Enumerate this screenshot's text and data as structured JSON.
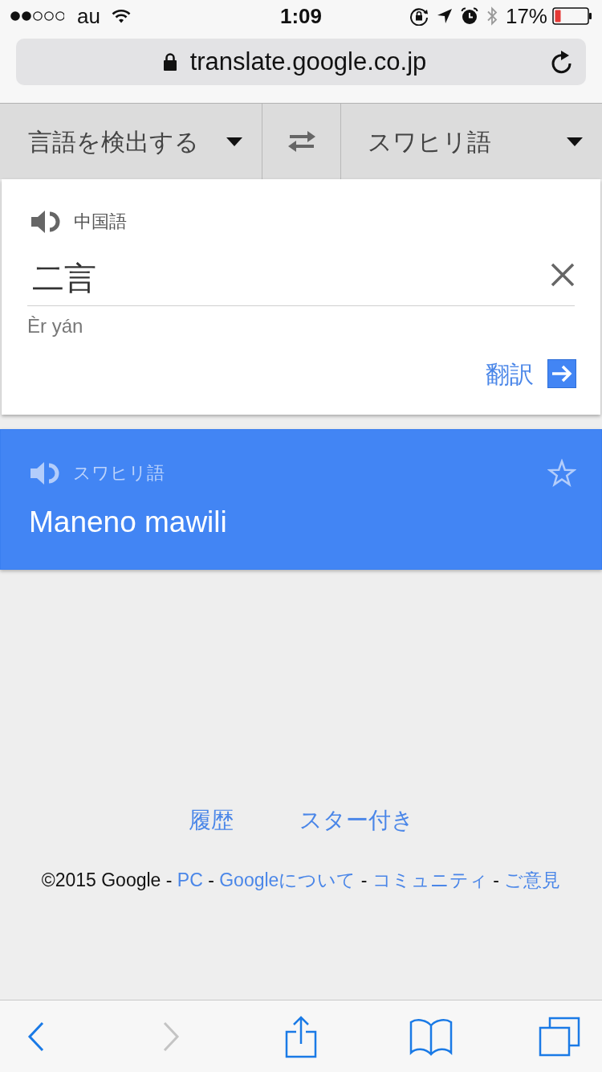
{
  "status_bar": {
    "carrier": "au",
    "time": "1:09",
    "battery_text": "17%"
  },
  "address_bar": {
    "url": "translate.google.co.jp"
  },
  "language_bar": {
    "source_language": "言語を検出する",
    "target_language": "スワヒリ語"
  },
  "input_card": {
    "detected_language": "中国語",
    "text": "二言",
    "romanization": "Èr yán",
    "translate_button": "翻訳"
  },
  "result_card": {
    "language": "スワヒリ語",
    "translation": "Maneno mawili",
    "starred": false
  },
  "footer": {
    "links": [
      "履歴",
      "スター付き"
    ],
    "legal_line": [
      {
        "kind": "text",
        "text": "©2015 Google -"
      },
      {
        "kind": "link",
        "text": "PC"
      },
      {
        "kind": "text",
        "text": "-"
      },
      {
        "kind": "link",
        "text": "Googleについて"
      },
      {
        "kind": "text",
        "text": "-"
      },
      {
        "kind": "link",
        "text": "コミュニティ"
      },
      {
        "kind": "text",
        "text": "-"
      },
      {
        "kind": "link",
        "text": "ご意見"
      }
    ]
  },
  "toolbar": {
    "items": [
      {
        "kind": "back",
        "disabled": false
      },
      {
        "kind": "forward",
        "disabled": true
      },
      {
        "kind": "share",
        "disabled": false
      },
      {
        "kind": "bookmarks",
        "disabled": false
      },
      {
        "kind": "tabs",
        "disabled": false
      }
    ]
  }
}
